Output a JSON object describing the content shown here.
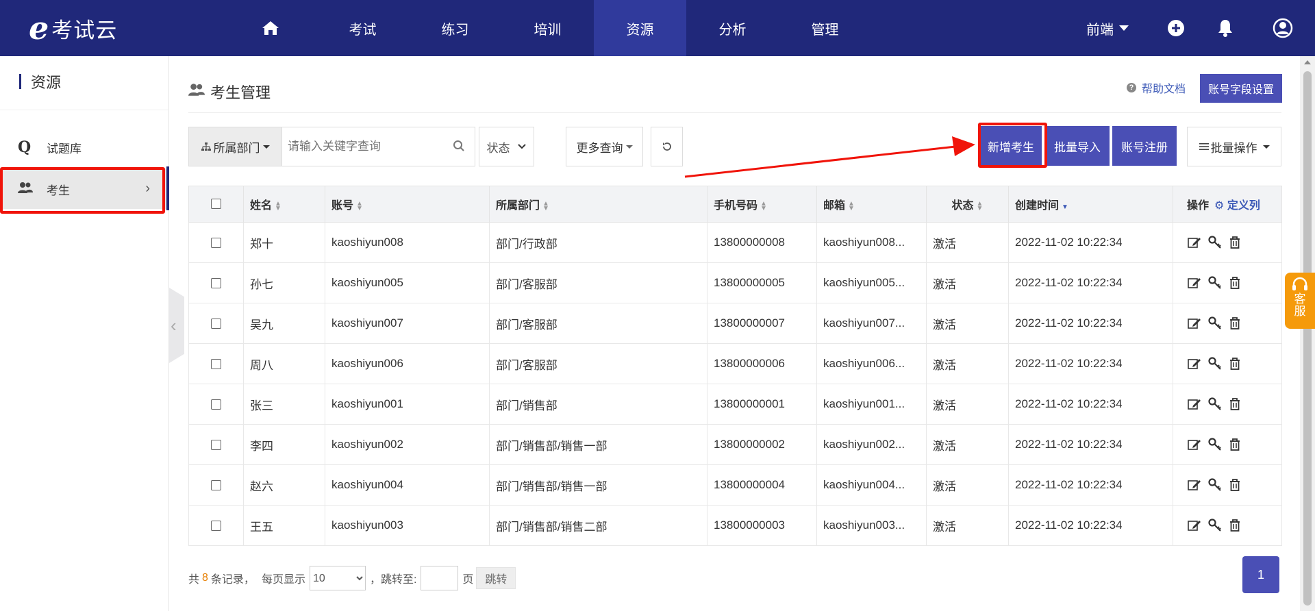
{
  "app": {
    "logo_letter": "e",
    "logo_text": "考试云"
  },
  "nav": {
    "items": [
      {
        "label": ""
      },
      {
        "label": "考试"
      },
      {
        "label": "练习"
      },
      {
        "label": "培训"
      },
      {
        "label": "资源"
      },
      {
        "label": "分析"
      },
      {
        "label": "管理"
      }
    ],
    "active_index": 4,
    "dropdown_label": "前端"
  },
  "sidebar": {
    "title": "资源",
    "items": [
      {
        "icon": "q-icon",
        "label": "试题库"
      },
      {
        "icon": "users-icon",
        "label": "考生",
        "selected": true
      }
    ]
  },
  "page": {
    "title": "考生管理",
    "help_label": "帮助文档",
    "field_settings_label": "账号字段设置"
  },
  "filters": {
    "dept_label": "所属部门",
    "search_placeholder": "请输入关键字查询",
    "status_label": "状态",
    "more_label": "更多查询"
  },
  "actions": {
    "add_label": "新增考生",
    "import_label": "批量导入",
    "register_label": "账号注册",
    "batch_label": "批量操作"
  },
  "table": {
    "headers": [
      "姓名",
      "账号",
      "所属部门",
      "手机号码",
      "邮箱",
      "状态",
      "创建时间",
      "操作"
    ],
    "define_label": "定义列",
    "rows": [
      {
        "name": "郑十",
        "account": "kaoshiyun008",
        "dept": "部门/行政部",
        "phone": "13800000008",
        "email": "kaoshiyun008...",
        "status": "激活",
        "created": "2022-11-02 10:22:34"
      },
      {
        "name": "孙七",
        "account": "kaoshiyun005",
        "dept": "部门/客服部",
        "phone": "13800000005",
        "email": "kaoshiyun005...",
        "status": "激活",
        "created": "2022-11-02 10:22:34"
      },
      {
        "name": "吴九",
        "account": "kaoshiyun007",
        "dept": "部门/客服部",
        "phone": "13800000007",
        "email": "kaoshiyun007...",
        "status": "激活",
        "created": "2022-11-02 10:22:34"
      },
      {
        "name": "周八",
        "account": "kaoshiyun006",
        "dept": "部门/客服部",
        "phone": "13800000006",
        "email": "kaoshiyun006...",
        "status": "激活",
        "created": "2022-11-02 10:22:34"
      },
      {
        "name": "张三",
        "account": "kaoshiyun001",
        "dept": "部门/销售部",
        "phone": "13800000001",
        "email": "kaoshiyun001...",
        "status": "激活",
        "created": "2022-11-02 10:22:34"
      },
      {
        "name": "李四",
        "account": "kaoshiyun002",
        "dept": "部门/销售部/销售一部",
        "phone": "13800000002",
        "email": "kaoshiyun002...",
        "status": "激活",
        "created": "2022-11-02 10:22:34"
      },
      {
        "name": "赵六",
        "account": "kaoshiyun004",
        "dept": "部门/销售部/销售一部",
        "phone": "13800000004",
        "email": "kaoshiyun004...",
        "status": "激活",
        "created": "2022-11-02 10:22:34"
      },
      {
        "name": "王五",
        "account": "kaoshiyun003",
        "dept": "部门/销售部/销售二部",
        "phone": "13800000003",
        "email": "kaoshiyun003...",
        "status": "激活",
        "created": "2022-11-02 10:22:34"
      }
    ]
  },
  "pagination": {
    "prefix": "共",
    "total": "8",
    "suffix": "条记录，",
    "per_page_label": "每页显示",
    "per_page_value": "10",
    "jump_label": "，跳转至:",
    "page_unit": "页",
    "jump_button": "跳转",
    "current_page": "1"
  },
  "kefu": {
    "line1": "客",
    "line2": "服"
  },
  "colors": {
    "nav_bg": "#20287a",
    "primary": "#4a4fb5",
    "highlight": "#f0140a",
    "kefu": "#f59a0b"
  }
}
